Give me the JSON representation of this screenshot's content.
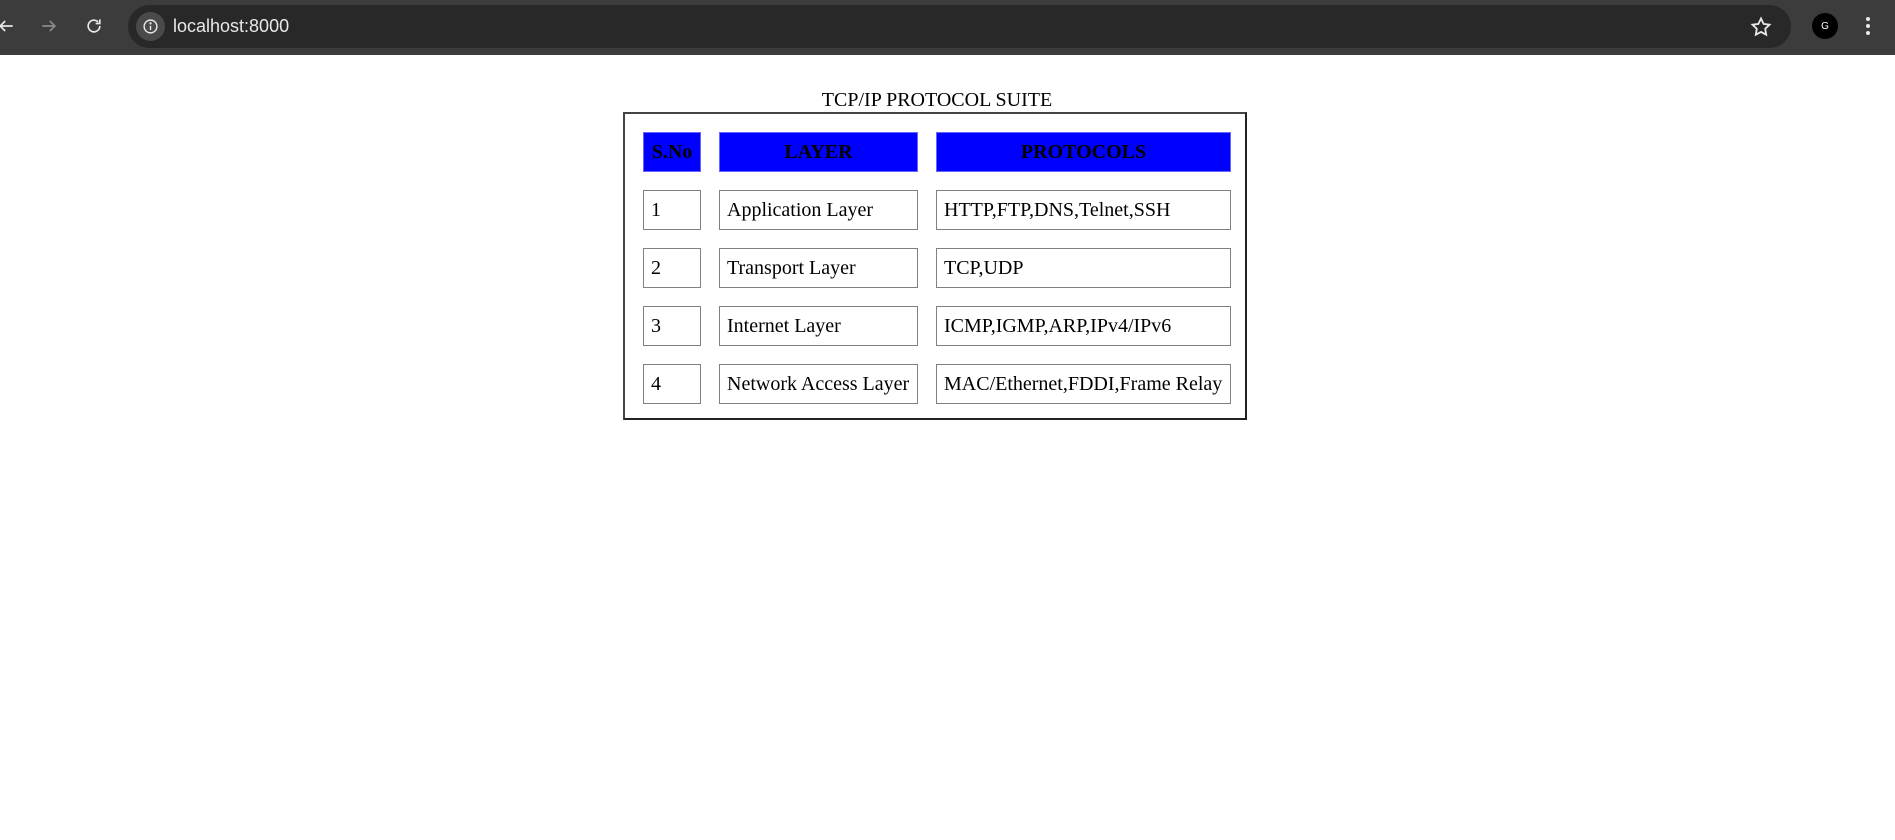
{
  "browser": {
    "url": "localhost:8000",
    "profile_initial": "G"
  },
  "table": {
    "caption": "TCP/IP PROTOCOL SUITE",
    "header_color": "#0000ff",
    "headers": [
      "S.No",
      "LAYER",
      "PROTOCOLS"
    ],
    "rows": [
      [
        "1",
        "Application Layer",
        "HTTP,FTP,DNS,Telnet,SSH"
      ],
      [
        "2",
        "Transport Layer",
        "TCP,UDP"
      ],
      [
        "3",
        "Internet Layer",
        "ICMP,IGMP,ARP,IPv4/IPv6"
      ],
      [
        "4",
        "Network Access Layer",
        "MAC/Ethernet,FDDI,Frame Relay"
      ]
    ]
  }
}
